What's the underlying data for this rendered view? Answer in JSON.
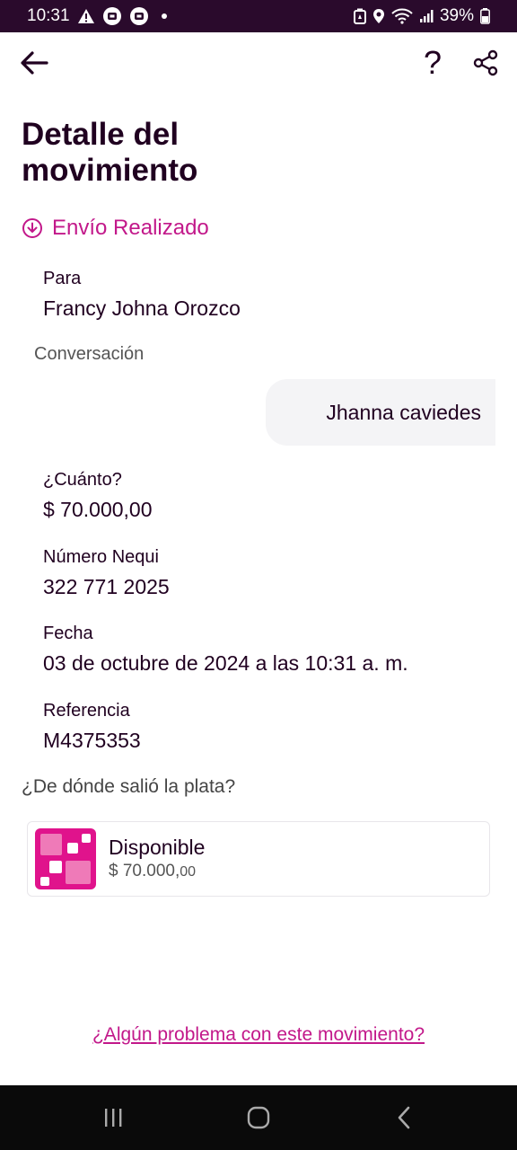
{
  "status_bar": {
    "time": "10:31",
    "battery": "39%",
    "icons_left": [
      "warning-icon",
      "notification-icon",
      "notification-icon",
      "dot"
    ],
    "icons_right": [
      "battery-saver-icon",
      "location-icon",
      "wifi-icon",
      "signal-icon",
      "battery-icon"
    ]
  },
  "header": {
    "back_icon": "arrow-left-icon",
    "help_label": "?",
    "share_icon": "share-icon"
  },
  "page": {
    "title": "Detalle del movimiento",
    "status": "Envío Realizado",
    "status_icon": "arrow-down-circle-icon"
  },
  "details": {
    "to_label": "Para",
    "to_value": "Francy Johna Orozco",
    "conversation_label": "Conversación",
    "conversation_message": "Jhanna caviedes",
    "amount_label": "¿Cuánto?",
    "amount_value": "$ 70.000,00",
    "number_label": "Número Nequi",
    "number_value": "322 771 2025",
    "date_label": "Fecha",
    "date_value": "03 de octubre de 2024 a las 10:31 a. m.",
    "reference_label": "Referencia",
    "reference_value": "M4375353"
  },
  "source": {
    "label": "¿De dónde salió la plata?",
    "account_name": "Disponible",
    "amount_main": "$ 70.000,",
    "amount_cents": "00"
  },
  "footer": {
    "problem_link": "¿Algún problema con este movimiento?"
  },
  "colors": {
    "accent": "#c2188a",
    "text": "#200020",
    "status_bar_bg": "#2a0a2c",
    "nav_bar_bg": "#0a0a0a"
  }
}
